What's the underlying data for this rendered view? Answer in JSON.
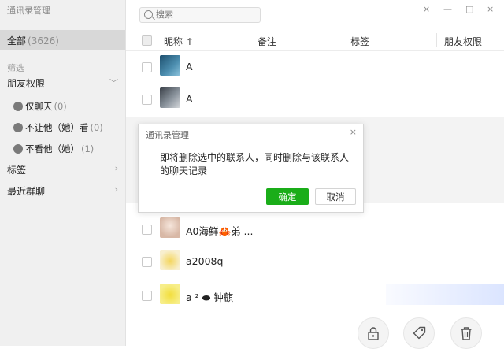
{
  "window": {
    "title": "通讯录管理",
    "controls": {
      "close": "×",
      "minimize": "—",
      "maximize": "□",
      "close2": "×"
    }
  },
  "sidebar": {
    "all": {
      "label": "全部",
      "count": "(3626)"
    },
    "filter_label": "筛选",
    "friend_perm": {
      "label": "朋友权限",
      "chevron": "﹀"
    },
    "sub": [
      {
        "label": "仅聊天",
        "count": "(0)"
      },
      {
        "label": "不让他（她）看",
        "count": "(0)"
      },
      {
        "label": "不看他（她）",
        "count": "(1)"
      }
    ],
    "tags": {
      "label": "标签",
      "chevron": "›"
    },
    "groups": {
      "label": "最近群聊",
      "chevron": "›"
    }
  },
  "search": {
    "placeholder": "搜索"
  },
  "table": {
    "headers": {
      "nickname": "昵称 ↑",
      "remark": "备注",
      "tags": "标签",
      "perm": "朋友权限"
    },
    "rows": [
      {
        "name": "A",
        "avatar_color": "#2f6a8a"
      },
      {
        "name": "A",
        "avatar_color": "#5a6470"
      },
      {
        "name": "A0海鲜🦀弟 ...",
        "avatar_color": "#e9d4c8"
      },
      {
        "name": "a2008q",
        "avatar_color": "#f1d46a"
      },
      {
        "name": "a  ² ⬬ 钟麒",
        "avatar_color": "#f3e25a"
      }
    ]
  },
  "dialog": {
    "title": "通讯录管理",
    "close": "×",
    "message": "即将删除选中的联系人，同时删除与该联系人的聊天记录",
    "confirm": "确定",
    "cancel": "取消"
  },
  "actions": [
    "lock-icon",
    "tag-icon",
    "trash-icon"
  ],
  "colors": {
    "accent": "#1aad19",
    "sidebar_bg": "#f0f0f0",
    "selected_bg": "#d8d8d8"
  }
}
